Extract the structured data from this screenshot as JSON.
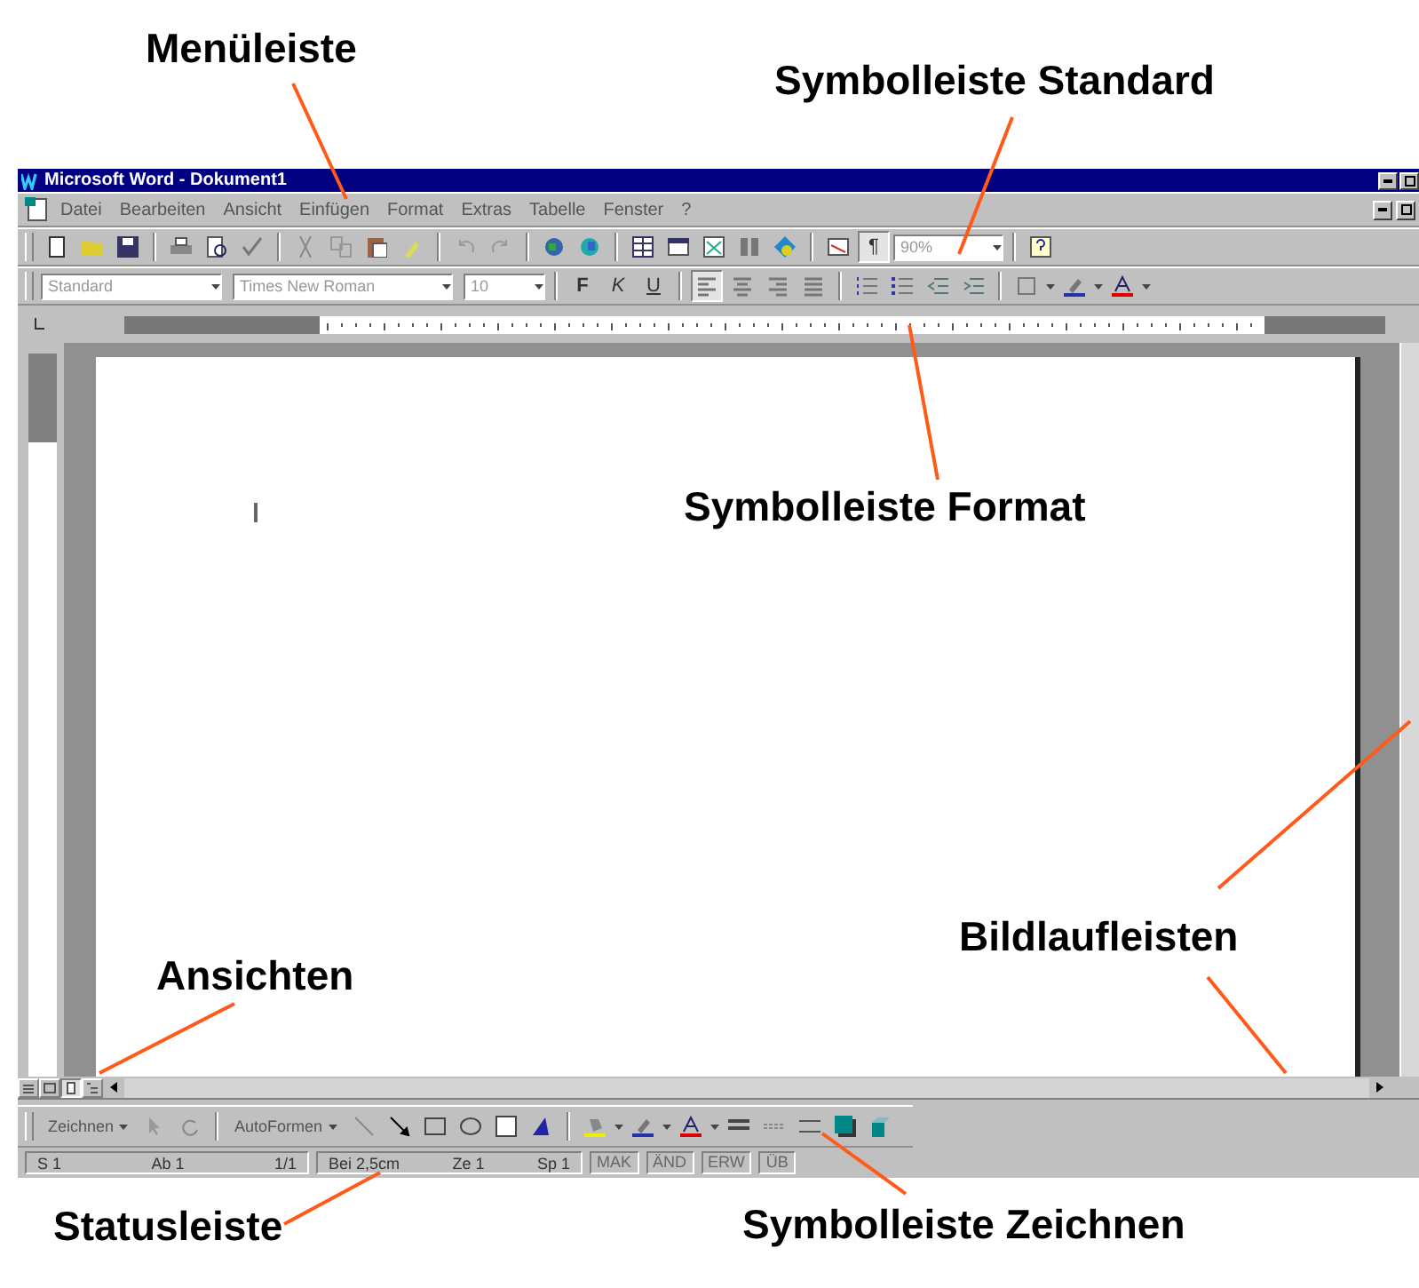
{
  "annotations": [
    {
      "kind": "menu",
      "text": "Menüleiste"
    },
    {
      "kind": "standard",
      "text": "Symbolleiste Standard"
    },
    {
      "kind": "format",
      "text": "Symbolleiste Format"
    },
    {
      "kind": "scroll",
      "text": "Bildlaufleisten"
    },
    {
      "kind": "views",
      "text": "Ansichten"
    },
    {
      "kind": "status",
      "text": "Statusleiste"
    },
    {
      "kind": "drawing",
      "text": "Symbolleiste Zeichnen"
    }
  ],
  "window": {
    "title": "Microsoft Word - Dokument1"
  },
  "menu": [
    "Datei",
    "Bearbeiten",
    "Ansicht",
    "Einfügen",
    "Format",
    "Extras",
    "Tabelle",
    "Fenster",
    "?"
  ],
  "standard_toolbar": {
    "zoom": "90%",
    "show_formatting": {
      "label": "¶",
      "selected": true
    }
  },
  "format_toolbar": {
    "style": "Standard",
    "font": "Times New Roman",
    "size": "10",
    "text_buttons": [
      {
        "label": "F",
        "kind": "bold"
      },
      {
        "label": "K",
        "kind": "italic"
      },
      {
        "label": "U",
        "kind": "underline"
      }
    ],
    "alignments": [
      {
        "kind": "left",
        "selected": true
      },
      {
        "kind": "center",
        "selected": false
      },
      {
        "kind": "right",
        "selected": false
      },
      {
        "kind": "justify",
        "selected": false
      }
    ]
  },
  "views": [
    {
      "kind": "normal",
      "selected": false
    },
    {
      "kind": "online",
      "selected": false
    },
    {
      "kind": "page",
      "selected": true
    },
    {
      "kind": "outline",
      "selected": false
    }
  ],
  "drawing_toolbar": {
    "menus": [
      "Zeichnen",
      "AutoFormen"
    ]
  },
  "status_bar": {
    "fields": [
      "S 1",
      "Ab 1",
      "1/1",
      "Bei 2,5cm",
      "Ze 1",
      "Sp 1"
    ],
    "modes": [
      {
        "label": "MAK",
        "disabled": true
      },
      {
        "label": "ÄND",
        "disabled": true
      },
      {
        "label": "ERW",
        "disabled": true
      },
      {
        "label": "ÜB",
        "disabled": true
      }
    ]
  }
}
